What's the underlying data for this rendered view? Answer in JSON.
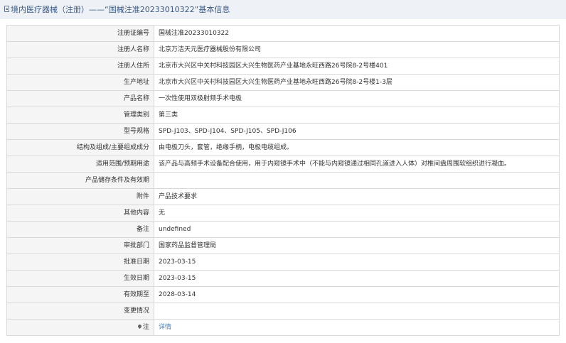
{
  "header": {
    "title": "境内医疗器械（注册）——“国械注准20233010322”基本信息"
  },
  "rows": [
    {
      "label": "注册证编号",
      "value": "国械注准20233010322"
    },
    {
      "label": "注册人名称",
      "value": "北京万洁天元医疗器械股份有限公司"
    },
    {
      "label": "注册人住所",
      "value": "北京市大兴区中关村科技园区大兴生物医药产业基地永旺西路26号院8-2号楼401"
    },
    {
      "label": "生产地址",
      "value": "北京市大兴区中关村科技园区大兴生物医药产业基地永旺西路26号院8-2号楼1-3层"
    },
    {
      "label": "产品名称",
      "value": "一次性使用双极射频手术电极"
    },
    {
      "label": "管理类别",
      "value": "第三类"
    },
    {
      "label": "型号规格",
      "value": "SPD-J103、SPD-J104、SPD-J105、SPD-J106"
    },
    {
      "label": "结构及组成/主要组成成分",
      "value": "由电极刀头，套管，绝缘手柄，电极电缆组成。"
    },
    {
      "label": "适用范围/预期用途",
      "value": "该产品与高频手术设备配合使用，用于内窥镜手术中（不能与内窥镜通过相同孔道进入人体）对椎间盘周围软组织进行凝血。"
    },
    {
      "label": "产品储存条件及有效期",
      "value": ""
    },
    {
      "label": "附件",
      "value": "产品技术要求"
    },
    {
      "label": "其他内容",
      "value": "无"
    },
    {
      "label": "备注",
      "value": "undefined"
    },
    {
      "label": "审批部门",
      "value": "国家药品监督管理局"
    },
    {
      "label": "批准日期",
      "value": "2023-03-15"
    },
    {
      "label": "生效日期",
      "value": "2023-03-15"
    },
    {
      "label": "有效期至",
      "value": "2028-03-14"
    },
    {
      "label": "变更情况",
      "value": ""
    }
  ],
  "note": {
    "label": "注",
    "icon": "pin-icon",
    "link_text": "详情"
  }
}
